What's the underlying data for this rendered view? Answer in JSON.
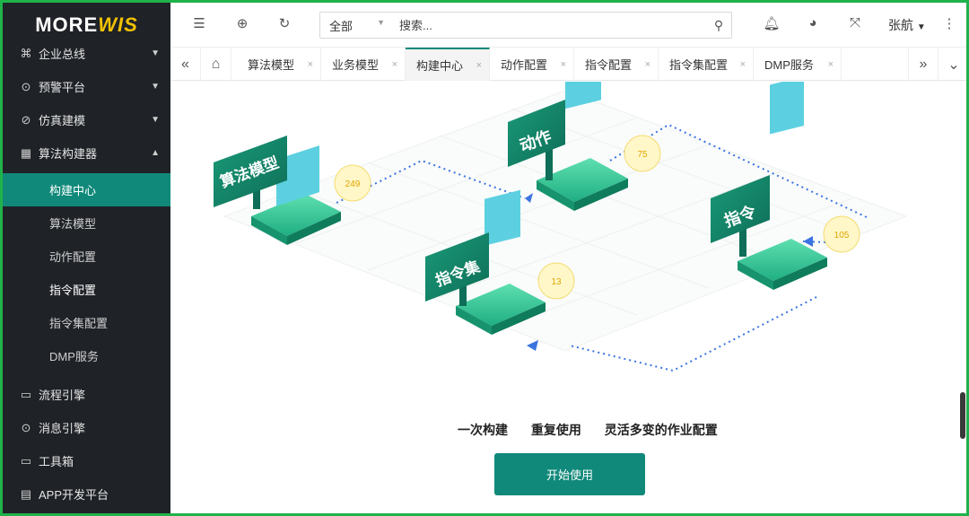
{
  "logo": {
    "part1": "MORE",
    "part2": "WIS"
  },
  "sidebar": {
    "items": [
      {
        "label": "企业总线",
        "icon": "command-icon"
      },
      {
        "label": "预警平台",
        "icon": "alert-icon"
      },
      {
        "label": "仿真建模",
        "icon": "sim-icon"
      },
      {
        "label": "算法构建器",
        "icon": "grid-icon"
      }
    ],
    "sub": [
      "构建中心",
      "算法模型",
      "动作配置",
      "指令配置",
      "指令集配置",
      "DMP服务"
    ],
    "items2": [
      {
        "label": "流程引擎",
        "icon": "monitor-icon"
      },
      {
        "label": "消息引擎",
        "icon": "message-icon"
      },
      {
        "label": "工具箱",
        "icon": "toolbox-icon"
      },
      {
        "label": "APP开发平台",
        "icon": "app-icon"
      }
    ]
  },
  "header": {
    "scope": "全部",
    "search_placeholder": "搜索...",
    "user": "张航"
  },
  "tabs": [
    "算法模型",
    "业务模型",
    "构建中心",
    "动作配置",
    "指令配置",
    "指令集配置",
    "DMP服务"
  ],
  "illustration": {
    "nodes": [
      {
        "label": "算法模型",
        "count": "249"
      },
      {
        "label": "动作",
        "count": "75"
      },
      {
        "label": "指令集",
        "count": "13"
      },
      {
        "label": "指令",
        "count": "105"
      }
    ]
  },
  "main": {
    "tagline": [
      "一次构建",
      "重复使用",
      "灵活多变的作业配置"
    ],
    "start_button": "开始使用"
  },
  "colors": {
    "accent": "#10897a",
    "sidebar_bg": "#1f2227",
    "border": "#1fb24a"
  }
}
